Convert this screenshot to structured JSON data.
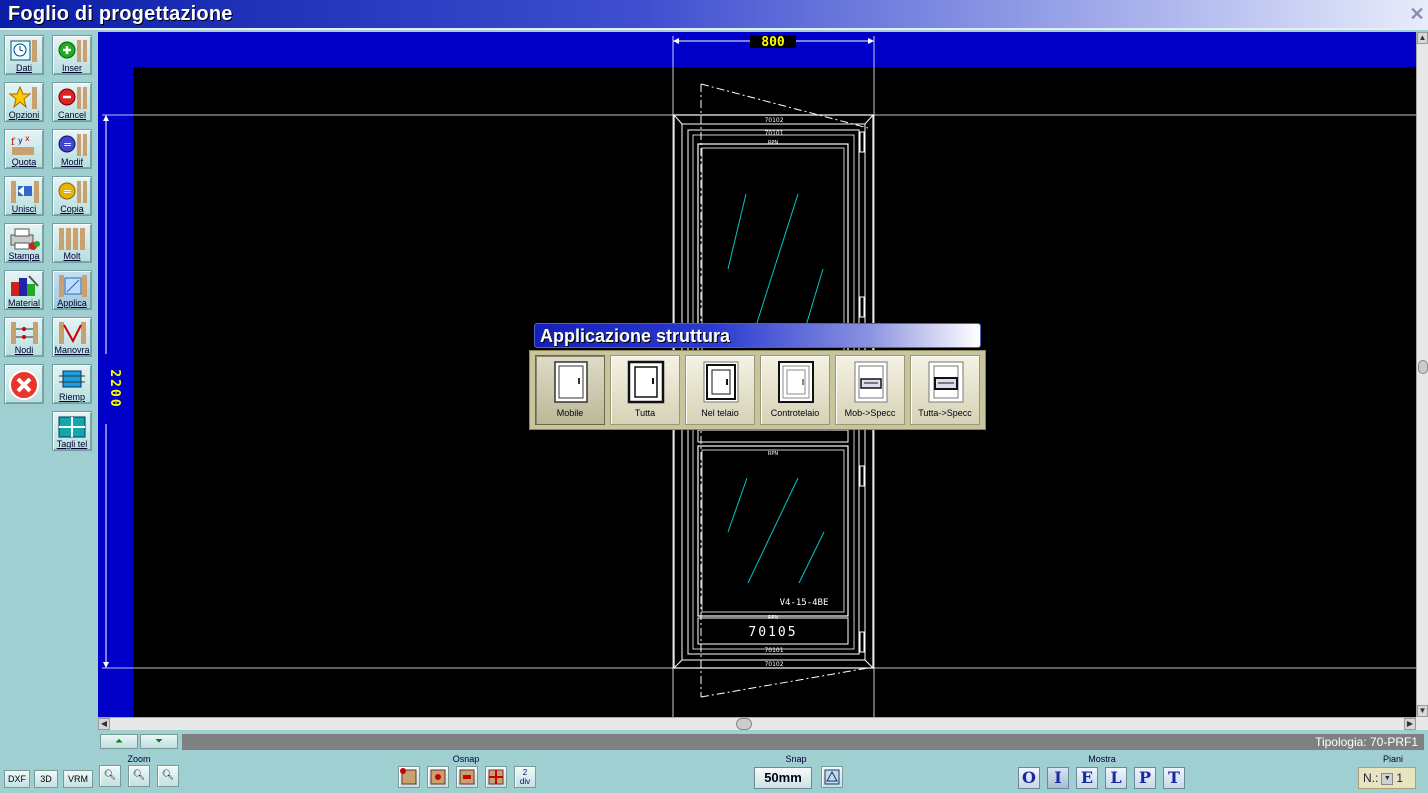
{
  "window": {
    "title": "Foglio di progettazione"
  },
  "left_tools": [
    {
      "label": "Dati",
      "icon": "clock-icon"
    },
    {
      "label": "Inser",
      "icon": "plus-icon"
    },
    {
      "label": "Opzioni",
      "icon": "star-icon"
    },
    {
      "label": "Cancel",
      "icon": "minus-icon"
    },
    {
      "label": "Quota",
      "icon": "dimension-icon"
    },
    {
      "label": "Modif",
      "icon": "modify-icon"
    },
    {
      "label": "Unisci",
      "icon": "join-icon"
    },
    {
      "label": "Copia",
      "icon": "copy-icon"
    },
    {
      "label": "Stampa",
      "icon": "printer-icon"
    },
    {
      "label": "Molt",
      "icon": "multiply-icon"
    },
    {
      "label": "Material",
      "icon": "material-icon"
    },
    {
      "label": "Applica",
      "icon": "apply-icon"
    },
    {
      "label": "Nodi",
      "icon": "nodes-icon"
    },
    {
      "label": "Manovra",
      "icon": "maneuver-icon"
    },
    {
      "label": "",
      "icon": "close-circle-icon"
    },
    {
      "label": "Riemp",
      "icon": "fill-icon"
    },
    {
      "label": "Tagli tel",
      "icon": "cut-frame-icon"
    }
  ],
  "drawing": {
    "width_dimension": "800",
    "height_dimension": "2200",
    "profile_top_outer": "70102",
    "profile_top_inner": "70101",
    "profile_bottom_inner": "70101",
    "profile_bottom_outer": "70102",
    "sash_label": "RPN",
    "glass_code": "V4-15-4BE",
    "transom_code": "70105"
  },
  "panel": {
    "title": "Applicazione struttura",
    "options": [
      {
        "label": "Mobile",
        "selected": true
      },
      {
        "label": "Tutta",
        "selected": false
      },
      {
        "label": "Nel telaio",
        "selected": false
      },
      {
        "label": "Controtelaio",
        "selected": false
      },
      {
        "label": "Mob->Specc",
        "selected": false
      },
      {
        "label": "Tutta->Specc",
        "selected": false
      }
    ]
  },
  "status": {
    "tipologia": "Tipologia: 70-PRF1"
  },
  "bottom": {
    "export": [
      "DXF",
      "3D",
      "VRM"
    ],
    "zoom_label": "Zoom",
    "osnap_label": "Osnap",
    "osnap_div": "2\ndiv",
    "snap_label": "Snap",
    "snap_value": "50mm",
    "mostra_label": "Mostra",
    "mostra": [
      "O",
      "I",
      "E",
      "L",
      "P",
      "T"
    ],
    "piani_label": "Piani",
    "piani_prefix": "N.:",
    "piani_value": "1"
  },
  "colors": {
    "canvas_border": "#0000c8",
    "canvas": "#000000",
    "dimension_text": "#ffff00",
    "glass_hatch": "#00c8c8",
    "panel_bg": "#c8c49c"
  }
}
